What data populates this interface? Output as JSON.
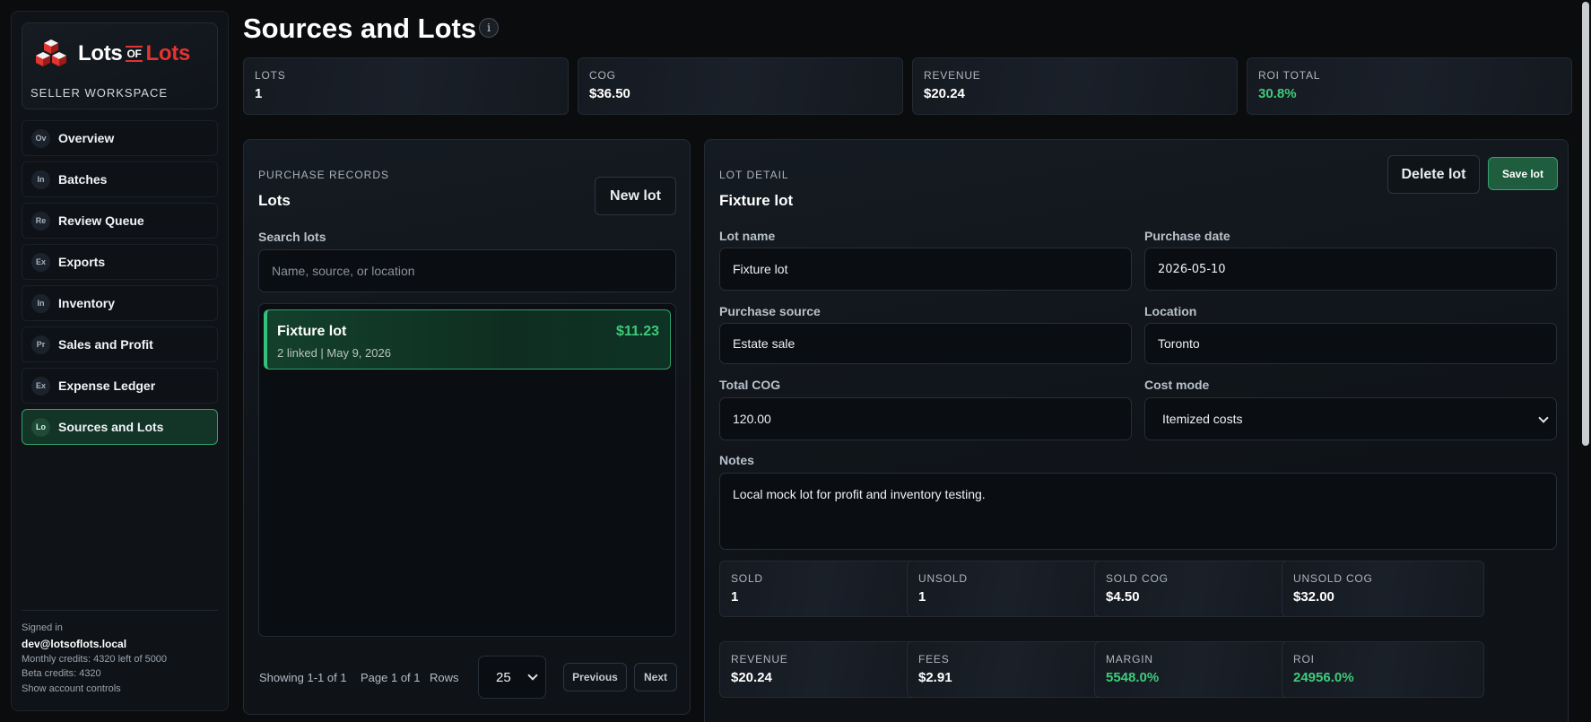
{
  "brand": {
    "word1": "Lots",
    "of": "OF",
    "word2": "Lots",
    "subtitle": "SELLER WORKSPACE"
  },
  "nav": [
    {
      "badge": "Ov",
      "label": "Overview"
    },
    {
      "badge": "In",
      "label": "Batches"
    },
    {
      "badge": "Re",
      "label": "Review Queue"
    },
    {
      "badge": "Ex",
      "label": "Exports"
    },
    {
      "badge": "In",
      "label": "Inventory"
    },
    {
      "badge": "Pr",
      "label": "Sales and Profit"
    },
    {
      "badge": "Ex",
      "label": "Expense Ledger"
    },
    {
      "badge": "Lo",
      "label": "Sources and Lots",
      "active": true
    }
  ],
  "account": {
    "signed_in": "Signed in",
    "email": "dev@lotsoflots.local",
    "monthly": "Monthly credits: 4320 left of 5000",
    "beta": "Beta credits: 4320",
    "controls": "Show account controls"
  },
  "page": {
    "title": "Sources and Lots",
    "info_icon": "i"
  },
  "stats": [
    {
      "label": "LOTS",
      "value": "1"
    },
    {
      "label": "COG",
      "value": "$36.50"
    },
    {
      "label": "REVENUE",
      "value": "$20.24"
    },
    {
      "label": "ROI TOTAL",
      "value": "30.8%",
      "color": "#3ecb7a"
    }
  ],
  "lots_panel": {
    "eyebrow": "PURCHASE RECORDS",
    "heading": "Lots",
    "new_button": "New lot",
    "search_label": "Search lots",
    "search_placeholder": "Name, source, or location",
    "items": [
      {
        "name": "Fixture lot",
        "meta": "2 linked | May 9, 2026",
        "amount": "$11.23"
      }
    ],
    "pager": {
      "showing": "Showing 1-1 of 1",
      "page": "Page 1 of 1",
      "rows_label": "Rows",
      "rows_value": "25",
      "prev": "Previous",
      "next": "Next"
    }
  },
  "detail": {
    "eyebrow": "LOT DETAIL",
    "heading": "Fixture lot",
    "delete_button": "Delete lot",
    "save_button": "Save lot",
    "fields": {
      "lot_name_label": "Lot name",
      "lot_name": "Fixture lot",
      "purchase_date_label": "Purchase date",
      "purchase_date": "2026-05-10",
      "source_label": "Purchase source",
      "source": "Estate sale",
      "location_label": "Location",
      "location": "Toronto",
      "cog_label": "Total COG",
      "cog": "120.00",
      "cost_mode_label": "Cost mode",
      "cost_mode": "Itemized costs",
      "notes_label": "Notes",
      "notes": "Local mock lot for profit and inventory testing."
    },
    "metrics_row1": [
      {
        "label": "SOLD",
        "value": "1"
      },
      {
        "label": "UNSOLD",
        "value": "1"
      },
      {
        "label": "SOLD COG",
        "value": "$4.50"
      },
      {
        "label": "UNSOLD COG",
        "value": "$32.00"
      }
    ],
    "metrics_row2": [
      {
        "label": "REVENUE",
        "value": "$20.24"
      },
      {
        "label": "FEES",
        "value": "$2.91"
      },
      {
        "label": "MARGIN",
        "value": "5548.0%",
        "color": "#3ecb7a"
      },
      {
        "label": "ROI",
        "value": "24956.0%",
        "color": "#3ecb7a"
      }
    ]
  },
  "colors": {
    "accent": "#3ecb7a",
    "brand_red": "#e3342f",
    "active_bg": "#123527"
  }
}
